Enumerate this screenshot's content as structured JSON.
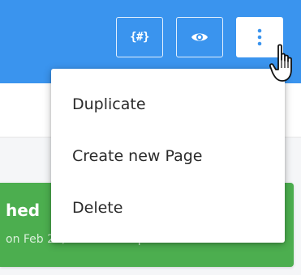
{
  "toolbar": {
    "variables_icon": "{#}",
    "preview_icon": "eye-icon",
    "more_icon": "vertical-dots-icon"
  },
  "menu": {
    "items": [
      {
        "label": "Duplicate"
      },
      {
        "label": "Create new Page"
      },
      {
        "label": "Delete"
      }
    ]
  },
  "card": {
    "title_fragment": "hed",
    "subtitle_fragment": "on Feb 23, 2023 · 2:27 pm"
  },
  "colors": {
    "topbar": "#3a94ee",
    "accent": "#3a94ee",
    "card": "#4cae4f",
    "menu_text": "#2b2b2b"
  }
}
